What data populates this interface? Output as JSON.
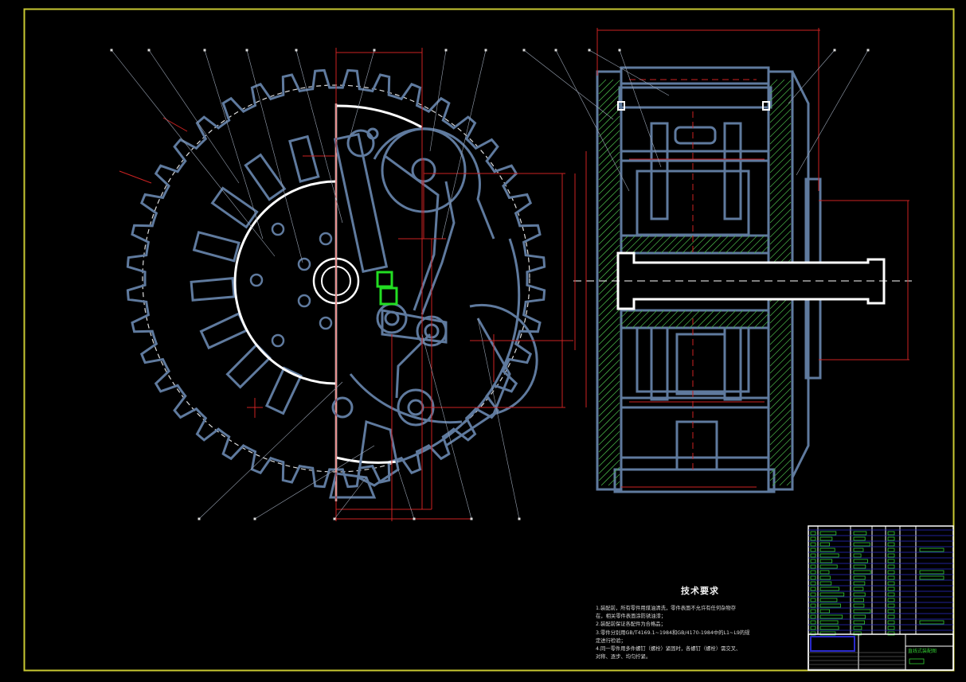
{
  "drawing": {
    "tech_requirements": {
      "title": "技术要求",
      "lines": [
        "1.装配前，所有零件用煤油清洗，零件表面不允许有任何杂物存",
        "在，相关零件表面涂防锈油漆；",
        "2.装配前保证各配件为合格品；",
        "3.零件分别用GB/T4169.1~1984和GB/4170-1984中的L1~L9的规",
        "定进行检验；",
        "4.同一零件用多件螺钉（螺栓）紧固时，各螺钉（螺栓）需交叉、",
        "对称、逐步、均匀拧紧。"
      ]
    },
    "title_block": {
      "drawing_name": "直线式装配图"
    },
    "colors": {
      "background": "#000000",
      "frame": "#c8c832",
      "outline": "#5f7a9e",
      "white": "#ffffff",
      "dimension": "#cc2222",
      "hatch": "#44aa44",
      "leader": "#9aa4b4"
    }
  }
}
